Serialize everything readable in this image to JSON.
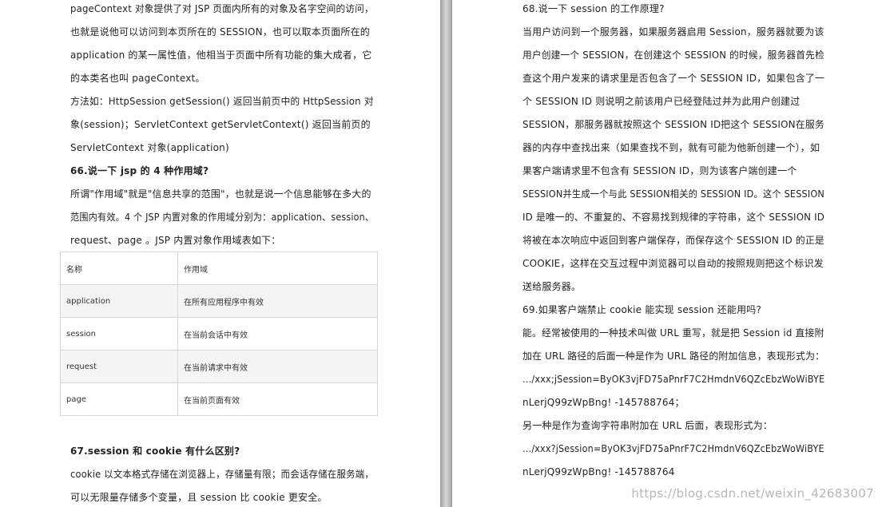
{
  "left_page": {
    "lines": [
      "pageContext 对象提供了对 JSP 页面内所有的对象及名字空间的访问，",
      "也就是说他可以访问到本页所在的 SESSION，也可以取本页面所在的",
      "application 的某一属性值，他相当于页面中所有功能的集大成者，它",
      "的本类名也叫 pageContext。",
      "方法如：HttpSession getSession() 返回当前页中的 HttpSession 对",
      "象(session)；ServletContext getServletContext() 返回当前页的",
      "ServletContext 对象(application)"
    ],
    "heading_66": "66.说一下 jsp 的 4 种作用域?",
    "para_66": [
      "所谓\"作用域\"就是\"信息共享的范围\"，也就是说一个信息能够在多大的",
      "范围内有效。4 个 JSP 内置对象的作用域分别为：application、session、",
      "request、page 。JSP 内置对象作用域表如下："
    ],
    "table": {
      "headers": [
        "名称",
        "作用域"
      ],
      "rows": [
        [
          "application",
          "在所有应用程序中有效"
        ],
        [
          "session",
          "在当前会话中有效"
        ],
        [
          "request",
          "在当前请求中有效"
        ],
        [
          "page",
          "在当前页面有效"
        ]
      ]
    },
    "heading_67": "67.session 和 cookie 有什么区别?",
    "para_67": [
      "cookie 以文本格式存储在浏览器上，存储量有限；而会话存储在服务端，",
      "可以无限量存储多个变量，且 session 比 cookie 更安全。"
    ]
  },
  "right_page": {
    "heading_68": "68.说一下 session 的工作原理?",
    "para_68": [
      "当用户访问到一个服务器，如果服务器启用 Session，服务器就要为该",
      "用户创建一个 SESSION，在创建这个 SESSION 的时候，服务器首先检",
      "查这个用户发来的请求里是否包含了一个 SESSION ID，如果包含了一",
      "个 SESSION ID 则说明之前该用户已经登陆过并为此用户创建过",
      "SESSION，那服务器就按照这个 SESSION ID把这个 SESSION在服务",
      "器的内存中查找出来（如果查找不到，就有可能为他新创建一个），如",
      "果客户端请求里不包含有 SESSION ID，则为该客户端创建一个",
      "SESSION并生成一个与此 SESSION相关的 SESSION ID。这个 SESSION",
      "ID 是唯一的、不重复的、不容易找到规律的字符串，这个 SESSION ID",
      "将被在本次响应中返回到客户端保存，而保存这个 SESSION ID 的正是",
      "COOKIE，这样在交互过程中浏览器可以自动的按照规则把这个标识发",
      "送给服务器。"
    ],
    "heading_69": "69.如果客户端禁止 cookie 能实现 session 还能用吗?",
    "para_69": [
      "能。经常被使用的一种技术叫做 URL 重写，就是把 Session id 直接附",
      "加在 URL 路径的后面一种是作为 URL 路径的附加信息，表现形式为：",
      "…/xxx;jSession=ByOK3vjFD75aPnrF7C2HmdnV6QZcEbzWoWiBYE",
      "nLerjQ99zWpBng! -145788764；",
      "另一种是作为查询字符串附加在 URL 后面，表现形式为：",
      "…/xxx?jSession=ByOK3vjFD75aPnrF7C2HmdnV6QZcEbzWoWiBYE",
      "nLerjQ99zWpBng! -145788764"
    ]
  },
  "watermark": "https://blog.csdn.net/weixin_42683007"
}
